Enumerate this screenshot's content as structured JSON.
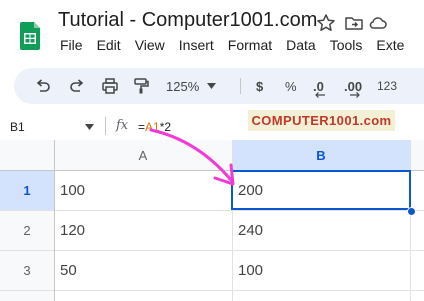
{
  "document": {
    "title": "Tutorial - Computer1001.com"
  },
  "menu": [
    "File",
    "Edit",
    "View",
    "Insert",
    "Format",
    "Data",
    "Tools",
    "Exte"
  ],
  "toolbar": {
    "zoom": "125%",
    "currency": "$",
    "percent": "%",
    "decrease_decimal": ".0",
    "increase_decimal": ".00",
    "number_format": "123"
  },
  "formula_bar": {
    "name_box": "B1",
    "fx": "fx",
    "formula_eq": "=",
    "formula_ref": "A1",
    "formula_rest": "*2"
  },
  "watermark": "COMPUTER1001.com",
  "sheet": {
    "columns": [
      "A",
      "B"
    ],
    "rows": [
      {
        "num": "1",
        "a": "100",
        "b": "200"
      },
      {
        "num": "2",
        "a": "120",
        "b": "240"
      },
      {
        "num": "3",
        "a": "50",
        "b": "100"
      }
    ]
  },
  "colors": {
    "accent": "#0b57d0",
    "arrow": "#f23ad7",
    "ref": "#e8710a",
    "header_selected": "#d3e3fd"
  }
}
